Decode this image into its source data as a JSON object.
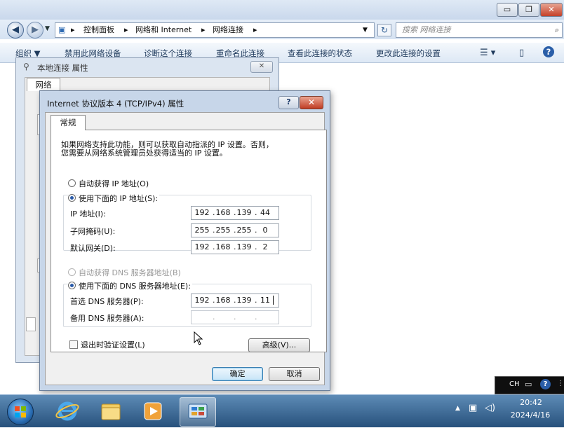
{
  "explorer": {
    "breadcrumb": [
      "控制面板",
      "网络和 Internet",
      "网络连接"
    ],
    "search_placeholder": "搜索 网络连接",
    "commands": {
      "organize": "组织 ▼",
      "disable": "禁用此网络设备",
      "diagnose": "诊断这个连接",
      "rename": "重命名此连接",
      "view_status": "查看此连接的状态",
      "change_settings": "更改此连接的设置"
    }
  },
  "lan_dialog": {
    "title": "本地连接 属性",
    "tab": "网络",
    "close_glyph": "✕"
  },
  "ipv4_dialog": {
    "title": "Internet 协议版本 4 (TCP/IPv4) 属性",
    "tab_general": "常规",
    "description_line1": "如果网络支持此功能，则可以获取自动指派的 IP 设置。否则，",
    "description_line2": "您需要从网络系统管理员处获得适当的 IP 设置。",
    "auto_ip_label": "自动获得 IP 地址(O)",
    "manual_ip_label": "使用下面的 IP 地址(S):",
    "ip_label": "IP 地址(I):",
    "ip_value": [
      "192",
      "168",
      "139",
      "44"
    ],
    "subnet_label": "子网掩码(U):",
    "subnet_value": [
      "255",
      "255",
      "255",
      "0"
    ],
    "gateway_label": "默认网关(D):",
    "gateway_value": [
      "192",
      "168",
      "139",
      "2"
    ],
    "auto_dns_label": "自动获得 DNS 服务器地址(B)",
    "manual_dns_label": "使用下面的 DNS 服务器地址(E):",
    "preferred_dns_label": "首选 DNS 服务器(P):",
    "preferred_dns_value": [
      "192",
      "168",
      "139",
      "11"
    ],
    "alternate_dns_label": "备用 DNS 服务器(A):",
    "validate_label": "退出时验证设置(L)",
    "advanced_button": "高级(V)...",
    "ok_button": "确定",
    "cancel_button": "取消",
    "help_glyph": "?",
    "close_glyph": "✕"
  },
  "tray": {
    "language": "CH",
    "time": "20:42",
    "date": "2024/4/16"
  },
  "colors": {
    "taskbar": "#27517c",
    "dialog_frame": "#c7d6e9",
    "close_red": "#c03d24"
  }
}
